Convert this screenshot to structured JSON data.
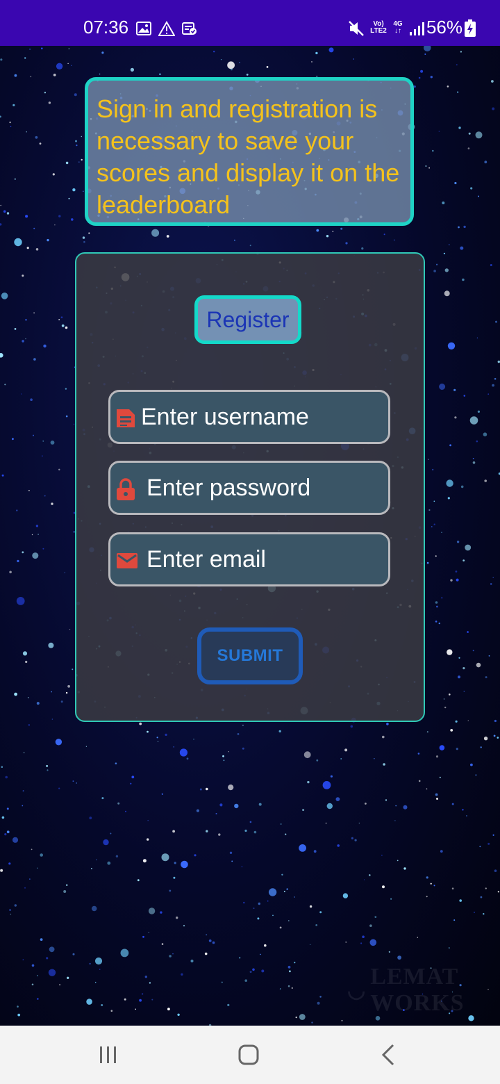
{
  "status_bar": {
    "time": "07:36",
    "battery_percent": "56%",
    "network_label_top": "Vo)",
    "network_label_bottom": "LTE2",
    "network_type": "4G",
    "icons": [
      "image-icon",
      "warning-icon",
      "clipboard-check-icon",
      "mute-icon",
      "signal-icon",
      "battery-charging-icon"
    ]
  },
  "info": {
    "message": "Sign in and registration is necessary to save your scores and display it on the leaderboard"
  },
  "form": {
    "title": "Register",
    "username_placeholder": "Enter username",
    "password_placeholder": "Enter password",
    "email_placeholder": "Enter email",
    "submit_label": "SUBMIT",
    "icons": [
      "document-icon",
      "lock-icon",
      "mail-icon"
    ]
  },
  "watermark": "LEMAT WORKS",
  "colors": {
    "status_bar": "#3a06b0",
    "info_text": "#f4c21c",
    "accent_border": "#1fd3c6",
    "register_text": "#1b35b5",
    "submit_text": "#2578d8",
    "icon_red": "#e0493d"
  },
  "nav_bar": {
    "icons": [
      "recent-apps-icon",
      "home-icon",
      "back-icon"
    ]
  }
}
